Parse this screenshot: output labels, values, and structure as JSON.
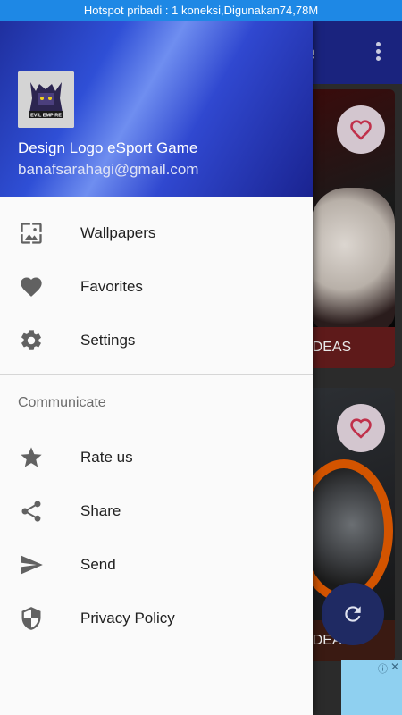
{
  "status_bar": {
    "text": "Hotspot pribadi : 1 koneksi,Digunakan74,78M"
  },
  "app": {
    "title": "me",
    "more_icon": "more-vertical-icon",
    "cards": [
      {
        "caption": "RT IDEAS",
        "favorite_icon": "heart-icon"
      },
      {
        "caption": "RT IDEAS",
        "favorite_icon": "heart-icon"
      }
    ],
    "refresh_icon": "refresh-icon",
    "ad": {
      "info": "ⓘ",
      "close": "✕"
    }
  },
  "drawer": {
    "header": {
      "app_name": "Design Logo eSport Game",
      "email": "banafsarahagi@gmail.com",
      "avatar_text": "EVIL EMPIRE"
    },
    "items": [
      {
        "label": "Wallpapers",
        "icon": "wallpaper-icon"
      },
      {
        "label": "Favorites",
        "icon": "heart-icon"
      },
      {
        "label": "Settings",
        "icon": "gear-icon"
      }
    ],
    "section_label": "Communicate",
    "communicate_items": [
      {
        "label": "Rate us",
        "icon": "star-icon"
      },
      {
        "label": "Share",
        "icon": "share-icon"
      },
      {
        "label": "Send",
        "icon": "send-icon"
      },
      {
        "label": "Privacy Policy",
        "icon": "shield-icon"
      }
    ]
  },
  "colors": {
    "status_bar": "#1e88e5",
    "toolbar": "#1a237e",
    "drawer_bg": "#fafafa",
    "icon": "#616161"
  }
}
